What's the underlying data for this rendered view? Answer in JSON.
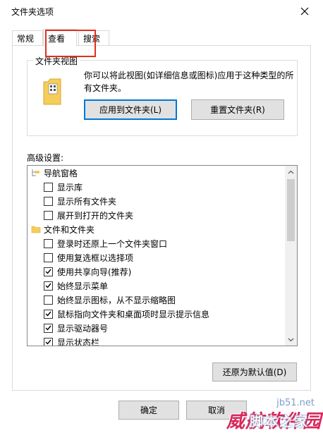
{
  "window": {
    "title": "文件夹选项",
    "close_icon": "close-icon"
  },
  "tabs": [
    {
      "label": "常规",
      "active": false
    },
    {
      "label": "查看",
      "active": true
    },
    {
      "label": "搜索",
      "active": false
    }
  ],
  "folder_views": {
    "title": "文件夹视图",
    "description": "你可以将此视图(如详细信息或图标)应用于这种类型的所有文件夹。",
    "apply_button": "应用到文件夹(L)",
    "reset_button": "重置文件夹(R)",
    "icon": "folder-view-icon"
  },
  "advanced": {
    "label": "高级设置:",
    "items": [
      {
        "type": "folder",
        "label": "导航窗格",
        "level": 0
      },
      {
        "type": "checkbox",
        "label": "显示库",
        "checked": false,
        "level": 1
      },
      {
        "type": "checkbox",
        "label": "显示所有文件夹",
        "checked": false,
        "level": 1
      },
      {
        "type": "checkbox",
        "label": "展开到打开的文件夹",
        "checked": false,
        "level": 1
      },
      {
        "type": "folder",
        "label": "文件和文件夹",
        "level": 0
      },
      {
        "type": "checkbox",
        "label": "登录时还原上一个文件夹窗口",
        "checked": false,
        "level": 1
      },
      {
        "type": "checkbox",
        "label": "使用复选框以选择项",
        "checked": false,
        "level": 1
      },
      {
        "type": "checkbox",
        "label": "使用共享向导(推荐)",
        "checked": true,
        "level": 1
      },
      {
        "type": "checkbox",
        "label": "始终显示菜单",
        "checked": true,
        "level": 1
      },
      {
        "type": "checkbox",
        "label": "始终显示图标，从不显示缩略图",
        "checked": false,
        "level": 1
      },
      {
        "type": "checkbox",
        "label": "鼠标指向文件夹和桌面项时显示提示信息",
        "checked": true,
        "level": 1
      },
      {
        "type": "checkbox",
        "label": "显示驱动器号",
        "checked": true,
        "level": 1
      },
      {
        "type": "checkbox",
        "label": "显示状态栏",
        "checked": true,
        "level": 1
      }
    ],
    "restore_button": "还原为默认值(D)"
  },
  "footer": {
    "ok_button": "确定",
    "cancel_button": "取消"
  },
  "watermark": {
    "site": "jb51.net",
    "main": "威航软件园",
    "sub": "脚本之家"
  },
  "colors": {
    "accent": "#0078d7",
    "highlight": "#e0301e",
    "folder": "#f5cd5a"
  }
}
